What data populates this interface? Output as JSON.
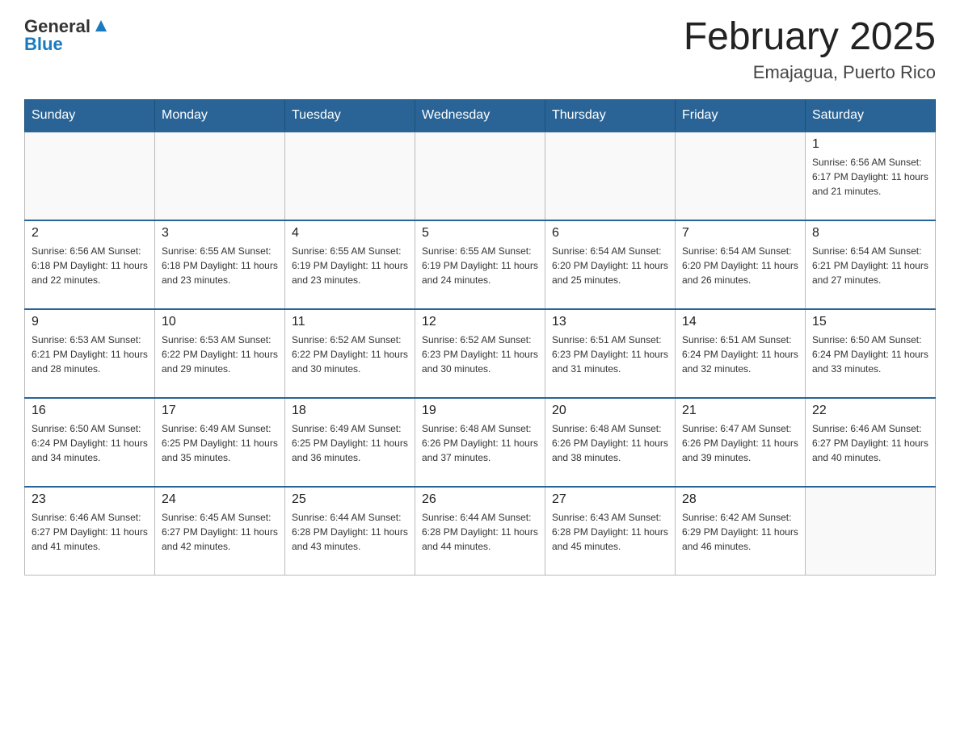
{
  "header": {
    "logo_general": "General",
    "logo_blue": "Blue",
    "month_title": "February 2025",
    "location": "Emajagua, Puerto Rico"
  },
  "weekdays": [
    "Sunday",
    "Monday",
    "Tuesday",
    "Wednesday",
    "Thursday",
    "Friday",
    "Saturday"
  ],
  "weeks": [
    [
      {
        "day": "",
        "info": ""
      },
      {
        "day": "",
        "info": ""
      },
      {
        "day": "",
        "info": ""
      },
      {
        "day": "",
        "info": ""
      },
      {
        "day": "",
        "info": ""
      },
      {
        "day": "",
        "info": ""
      },
      {
        "day": "1",
        "info": "Sunrise: 6:56 AM\nSunset: 6:17 PM\nDaylight: 11 hours\nand 21 minutes."
      }
    ],
    [
      {
        "day": "2",
        "info": "Sunrise: 6:56 AM\nSunset: 6:18 PM\nDaylight: 11 hours\nand 22 minutes."
      },
      {
        "day": "3",
        "info": "Sunrise: 6:55 AM\nSunset: 6:18 PM\nDaylight: 11 hours\nand 23 minutes."
      },
      {
        "day": "4",
        "info": "Sunrise: 6:55 AM\nSunset: 6:19 PM\nDaylight: 11 hours\nand 23 minutes."
      },
      {
        "day": "5",
        "info": "Sunrise: 6:55 AM\nSunset: 6:19 PM\nDaylight: 11 hours\nand 24 minutes."
      },
      {
        "day": "6",
        "info": "Sunrise: 6:54 AM\nSunset: 6:20 PM\nDaylight: 11 hours\nand 25 minutes."
      },
      {
        "day": "7",
        "info": "Sunrise: 6:54 AM\nSunset: 6:20 PM\nDaylight: 11 hours\nand 26 minutes."
      },
      {
        "day": "8",
        "info": "Sunrise: 6:54 AM\nSunset: 6:21 PM\nDaylight: 11 hours\nand 27 minutes."
      }
    ],
    [
      {
        "day": "9",
        "info": "Sunrise: 6:53 AM\nSunset: 6:21 PM\nDaylight: 11 hours\nand 28 minutes."
      },
      {
        "day": "10",
        "info": "Sunrise: 6:53 AM\nSunset: 6:22 PM\nDaylight: 11 hours\nand 29 minutes."
      },
      {
        "day": "11",
        "info": "Sunrise: 6:52 AM\nSunset: 6:22 PM\nDaylight: 11 hours\nand 30 minutes."
      },
      {
        "day": "12",
        "info": "Sunrise: 6:52 AM\nSunset: 6:23 PM\nDaylight: 11 hours\nand 30 minutes."
      },
      {
        "day": "13",
        "info": "Sunrise: 6:51 AM\nSunset: 6:23 PM\nDaylight: 11 hours\nand 31 minutes."
      },
      {
        "day": "14",
        "info": "Sunrise: 6:51 AM\nSunset: 6:24 PM\nDaylight: 11 hours\nand 32 minutes."
      },
      {
        "day": "15",
        "info": "Sunrise: 6:50 AM\nSunset: 6:24 PM\nDaylight: 11 hours\nand 33 minutes."
      }
    ],
    [
      {
        "day": "16",
        "info": "Sunrise: 6:50 AM\nSunset: 6:24 PM\nDaylight: 11 hours\nand 34 minutes."
      },
      {
        "day": "17",
        "info": "Sunrise: 6:49 AM\nSunset: 6:25 PM\nDaylight: 11 hours\nand 35 minutes."
      },
      {
        "day": "18",
        "info": "Sunrise: 6:49 AM\nSunset: 6:25 PM\nDaylight: 11 hours\nand 36 minutes."
      },
      {
        "day": "19",
        "info": "Sunrise: 6:48 AM\nSunset: 6:26 PM\nDaylight: 11 hours\nand 37 minutes."
      },
      {
        "day": "20",
        "info": "Sunrise: 6:48 AM\nSunset: 6:26 PM\nDaylight: 11 hours\nand 38 minutes."
      },
      {
        "day": "21",
        "info": "Sunrise: 6:47 AM\nSunset: 6:26 PM\nDaylight: 11 hours\nand 39 minutes."
      },
      {
        "day": "22",
        "info": "Sunrise: 6:46 AM\nSunset: 6:27 PM\nDaylight: 11 hours\nand 40 minutes."
      }
    ],
    [
      {
        "day": "23",
        "info": "Sunrise: 6:46 AM\nSunset: 6:27 PM\nDaylight: 11 hours\nand 41 minutes."
      },
      {
        "day": "24",
        "info": "Sunrise: 6:45 AM\nSunset: 6:27 PM\nDaylight: 11 hours\nand 42 minutes."
      },
      {
        "day": "25",
        "info": "Sunrise: 6:44 AM\nSunset: 6:28 PM\nDaylight: 11 hours\nand 43 minutes."
      },
      {
        "day": "26",
        "info": "Sunrise: 6:44 AM\nSunset: 6:28 PM\nDaylight: 11 hours\nand 44 minutes."
      },
      {
        "day": "27",
        "info": "Sunrise: 6:43 AM\nSunset: 6:28 PM\nDaylight: 11 hours\nand 45 minutes."
      },
      {
        "day": "28",
        "info": "Sunrise: 6:42 AM\nSunset: 6:29 PM\nDaylight: 11 hours\nand 46 minutes."
      },
      {
        "day": "",
        "info": ""
      }
    ]
  ]
}
